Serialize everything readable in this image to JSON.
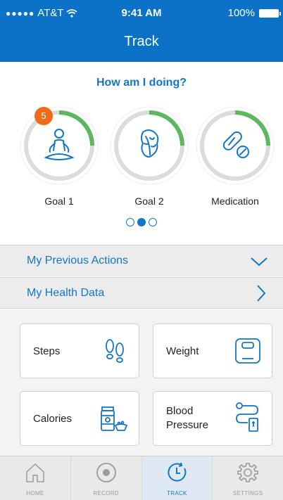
{
  "status_bar": {
    "carrier": "AT&T",
    "signal_dots": "●●●●●",
    "time": "9:41 AM",
    "battery": "100%"
  },
  "header": {
    "title": "Track"
  },
  "doing": {
    "title": "How am I doing?",
    "goals": [
      {
        "label": "Goal 1",
        "badge": "5",
        "icon": "meditation-icon",
        "progress": 0.25
      },
      {
        "label": "Goal 2",
        "badge": "",
        "icon": "lettuce-icon",
        "progress": 0.25
      },
      {
        "label": "Medication",
        "badge": "",
        "icon": "pills-icon",
        "progress": 0.25
      }
    ],
    "pager": {
      "pages": 3,
      "active": 2
    }
  },
  "rows": [
    {
      "label": "My Previous Actions",
      "icon": "chevron-down-icon"
    },
    {
      "label": "My Health Data",
      "icon": "chevron-right-icon"
    }
  ],
  "cards": [
    {
      "label": "Steps",
      "icon": "footprints-icon"
    },
    {
      "label": "Weight",
      "icon": "scale-icon"
    },
    {
      "label": "Calories",
      "icon": "food-icon"
    },
    {
      "label": "Blood\nPressure",
      "line1": "Blood",
      "line2": "Pressure",
      "icon": "blood-pressure-icon"
    }
  ],
  "tabs": [
    {
      "label": "HOME",
      "icon": "home-icon"
    },
    {
      "label": "RECORD",
      "icon": "record-icon"
    },
    {
      "label": "TRACK",
      "icon": "clock-icon",
      "active": true
    },
    {
      "label": "SETTINGS",
      "icon": "gear-icon"
    }
  ],
  "colors": {
    "brand": "#0b72c7",
    "accent": "#1276c8",
    "progress": "#5cb85c",
    "badge": "#f06a1a"
  }
}
